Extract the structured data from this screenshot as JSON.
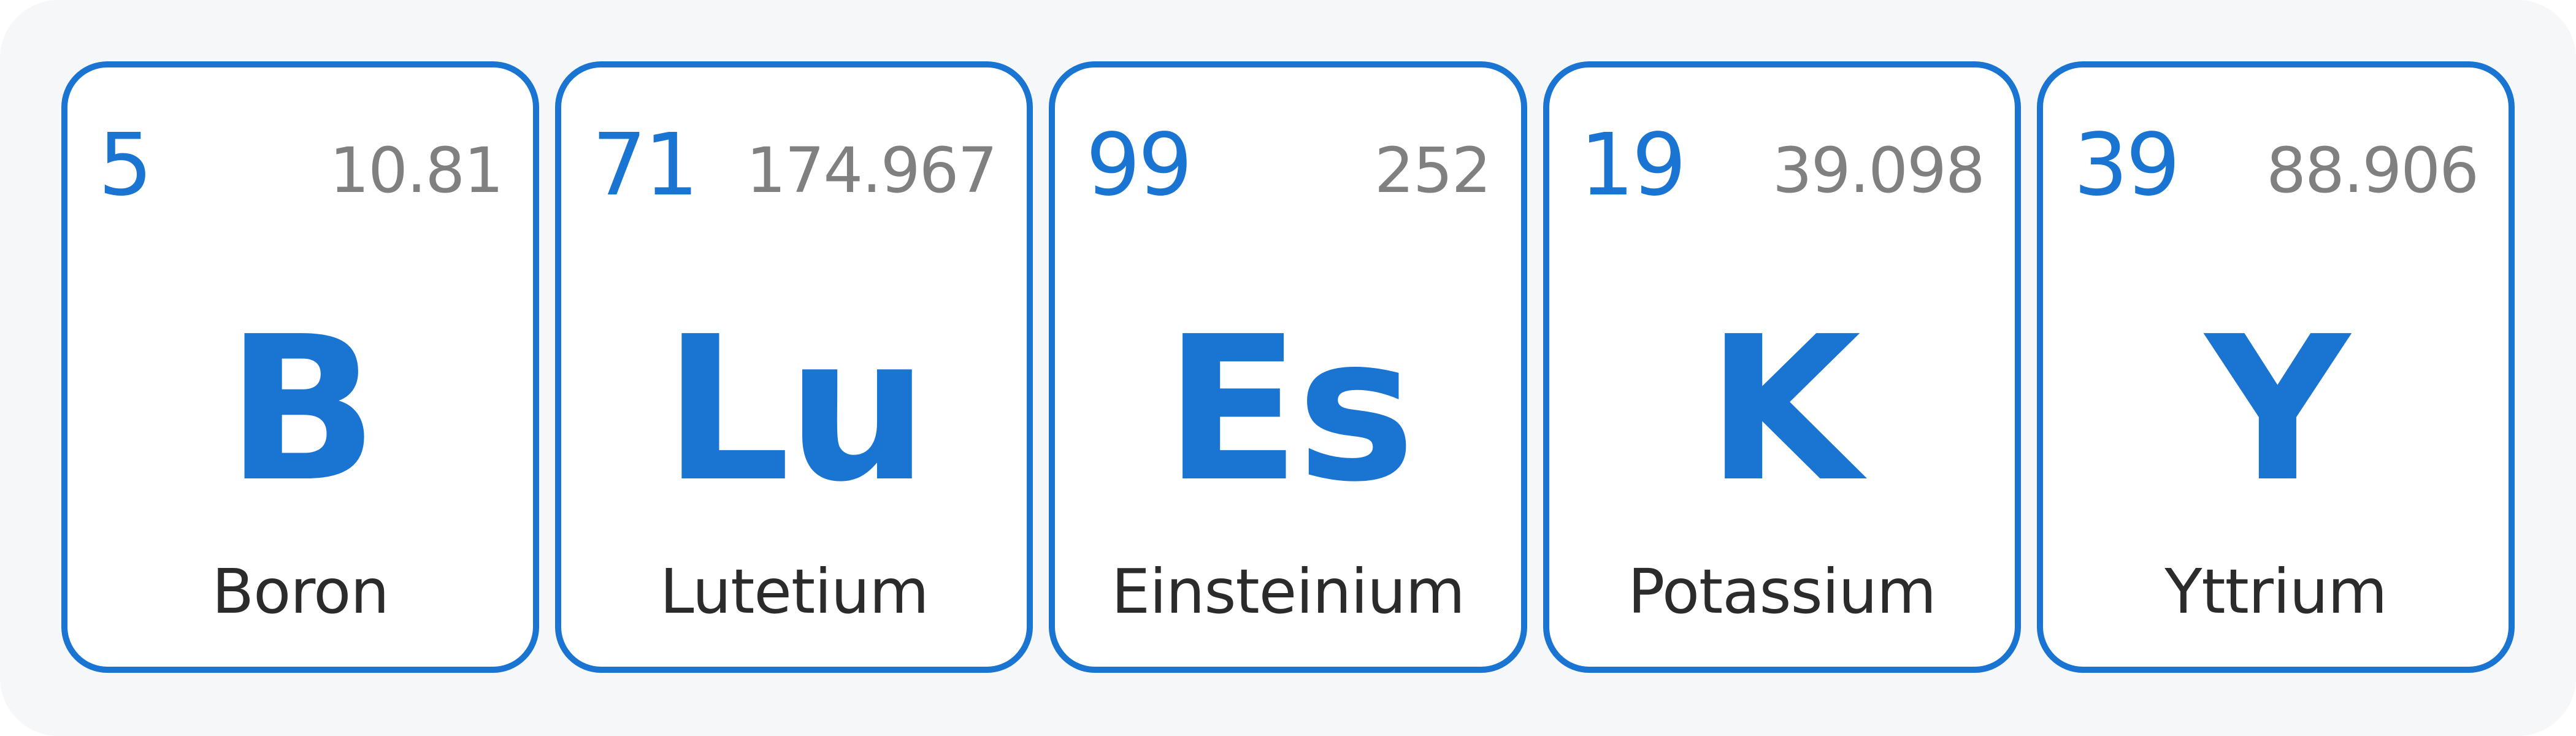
{
  "elements": [
    {
      "atomic_number": "5",
      "atomic_mass": "10.81",
      "symbol": "B",
      "name": "Boron"
    },
    {
      "atomic_number": "71",
      "atomic_mass": "174.967",
      "symbol": "Lu",
      "name": "Lutetium"
    },
    {
      "atomic_number": "99",
      "atomic_mass": "252",
      "symbol": "Es",
      "name": "Einsteinium"
    },
    {
      "atomic_number": "19",
      "atomic_mass": "39.098",
      "symbol": "K",
      "name": "Potassium"
    },
    {
      "atomic_number": "39",
      "atomic_mass": "88.906",
      "symbol": "Y",
      "name": "Yttrium"
    }
  ],
  "colors": {
    "accent": "#1a74d2",
    "mass_text": "#808080",
    "name_text": "#2b2b2b",
    "panel_background": "#f6f7f9",
    "tile_background": "#ffffff"
  }
}
